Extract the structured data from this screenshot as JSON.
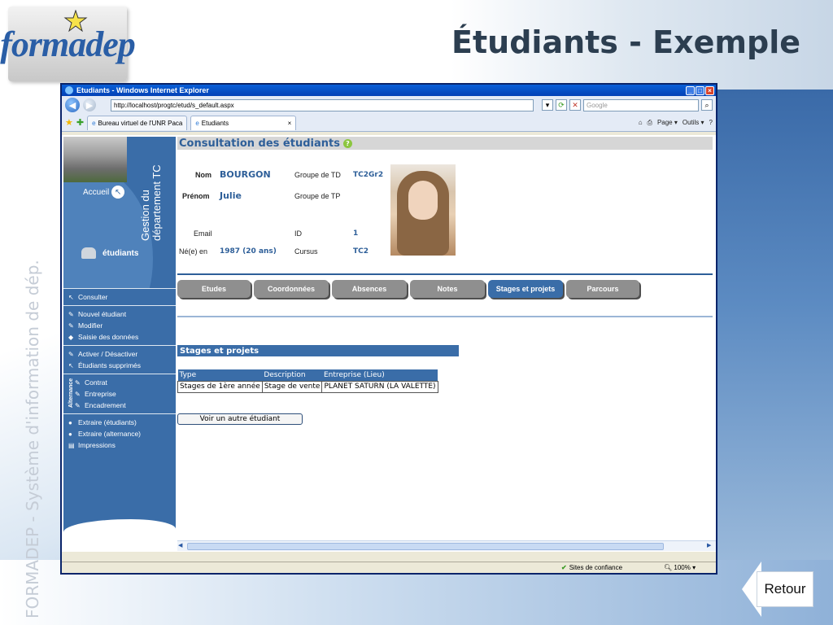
{
  "slide": {
    "title": "Étudiants - Exemple",
    "logo_text": "formadep",
    "side_text": "FORMADEP - Système d'information de dép.",
    "retour_label": "Retour"
  },
  "browser": {
    "window_title": "Etudiants - Windows Internet Explorer",
    "url": "http://localhost/progtc/etud/s_default.aspx",
    "search_placeholder": "Google",
    "tabs": [
      "Bureau virtuel de l'UNR Paca",
      "Etudiants"
    ],
    "tools": [
      "Page ▾",
      "Outils ▾"
    ],
    "status_trust": "Sites de confiance",
    "status_zoom": "100%"
  },
  "sidebar": {
    "accueil": "Accueil",
    "section_title_1": "Gestion du",
    "section_title_2": "département TC",
    "etudiants": "étudiants",
    "group1": [
      "Consulter"
    ],
    "group2": [
      "Nouvel étudiant",
      "Modifier",
      "Saisie des données"
    ],
    "group3": [
      "Activer / Désactiver",
      "Étudiants supprimés"
    ],
    "alternance_label": "Alternance",
    "group4": [
      "Contrat",
      "Entreprise",
      "Encadrement"
    ],
    "group5": [
      "Extraire (étudiants)",
      "Extraire (alternance)",
      "Impressions"
    ]
  },
  "content": {
    "heading": "Consultation des étudiants",
    "labels": {
      "nom": "Nom",
      "prenom": "Prénom",
      "email": "Email",
      "ne_en": "Né(e) en",
      "groupe_td": "Groupe de TD",
      "groupe_tp": "Groupe de TP",
      "id": "ID",
      "cursus": "Cursus"
    },
    "values": {
      "nom": "BOURGON",
      "prenom": "Julie",
      "email": "",
      "ne_en": "1987 (20 ans)",
      "groupe_td": "TC2Gr2",
      "groupe_tp": "",
      "id": "1",
      "cursus": "TC2"
    },
    "tabs": [
      "Etudes",
      "Coordonnées",
      "Absences",
      "Notes",
      "Stages et projets",
      "Parcours"
    ],
    "active_tab": "Stages et projets",
    "section_title": "Stages et projets",
    "table": {
      "headers": [
        "Type",
        "Description",
        "Entreprise (Lieu)"
      ],
      "rows": [
        [
          "Stages de 1ère année",
          "Stage de vente",
          "PLANET SATURN (LA VALETTE)"
        ]
      ]
    },
    "voir_button": "Voir un autre étudiant"
  },
  "colors": {
    "brand_blue": "#3a6da8",
    "accent_text": "#2e5f99",
    "tab_inactive": "#8f8f8f"
  }
}
